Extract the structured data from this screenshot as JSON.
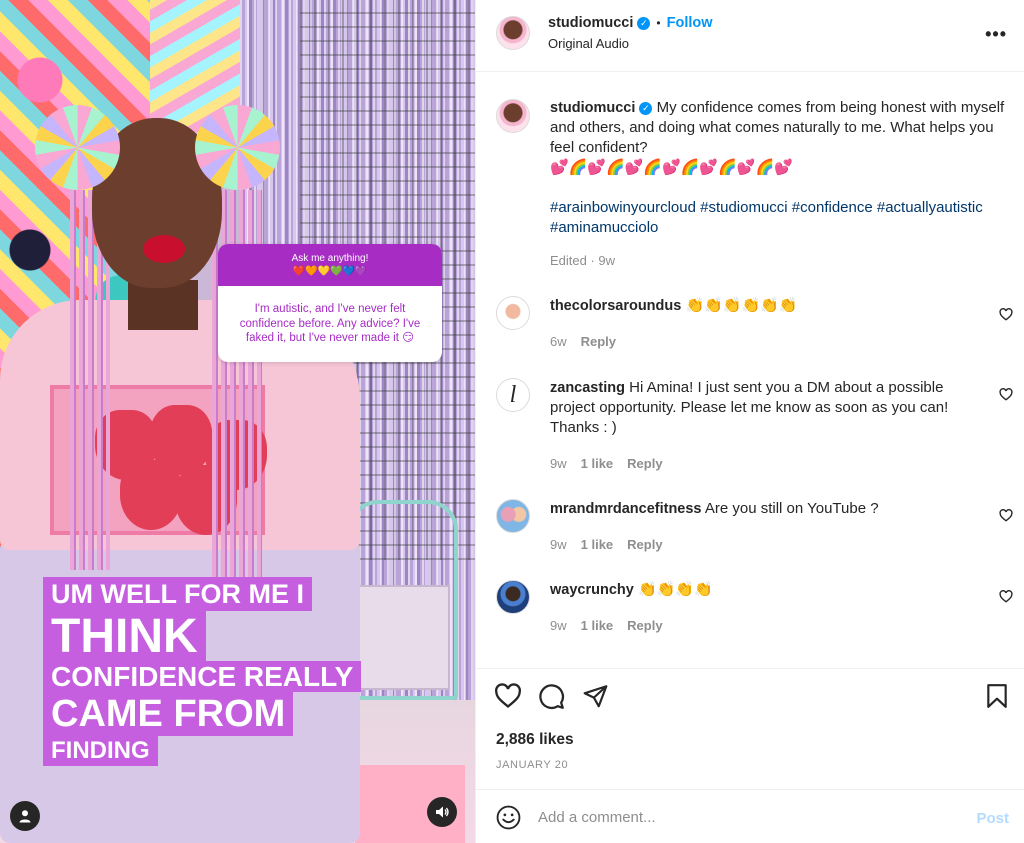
{
  "post": {
    "username": "studiomucci",
    "follow_label": "Follow",
    "audio_label": "Original Audio",
    "more_label": "•••",
    "caption": "My confidence comes from being honest with myself and others, and doing what comes naturally to me. What helps you feel confident?",
    "caption_emoji": "💕🌈💕🌈💕🌈💕🌈💕🌈💕🌈💕",
    "hashtags": "#arainbowinyourcloud #studiomucci #confidence #actuallyautistic #aminamucciolo",
    "edited": "Edited · 9w"
  },
  "video": {
    "question_title": "Ask me anything!",
    "question_emoji": "❤️🧡💛💚💙💜",
    "question_text": "I'm autistic, and I've never felt confidence before. Any advice? I've faked it, but I've never made it 😏",
    "caption_lines": [
      "UM WELL FOR ME I",
      "THINK",
      "CONFIDENCE REALLY",
      "CAME FROM",
      "FINDING"
    ]
  },
  "comments": [
    {
      "username": "thecolorsaroundus",
      "text": "👏👏👏👏👏👏",
      "time": "6w",
      "likes": "",
      "reply": "Reply"
    },
    {
      "username": "zancasting",
      "text": "Hi Amina! I just sent you a DM about a possible project opportunity. Please let me know as soon as you can! Thanks : )",
      "time": "9w",
      "likes": "1 like",
      "reply": "Reply"
    },
    {
      "username": "mrandmrdancefitness",
      "text": "Are you still on YouTube ?",
      "time": "9w",
      "likes": "1 like",
      "reply": "Reply"
    },
    {
      "username": "waycrunchy",
      "text": "👏👏👏👏",
      "time": "9w",
      "likes": "1 like",
      "reply": "Reply"
    }
  ],
  "actions": {
    "likes_count": "2,886 likes",
    "date": "JANUARY 20"
  },
  "add_comment": {
    "placeholder": "Add a comment...",
    "post_label": "Post"
  },
  "colors": {
    "accent": "#0095f6",
    "hashtag": "#00376b",
    "muted": "#8e8e8e",
    "caption_overlay": "#c55fe0",
    "question_header": "#a62cc4"
  },
  "icons": {
    "verified": "verified-badge-icon",
    "more": "more-options-icon",
    "like": "heart-icon",
    "comment": "comment-bubble-icon",
    "share": "paper-plane-icon",
    "save": "bookmark-icon",
    "emoji": "emoji-icon",
    "user": "user-icon",
    "sound": "speaker-icon"
  }
}
